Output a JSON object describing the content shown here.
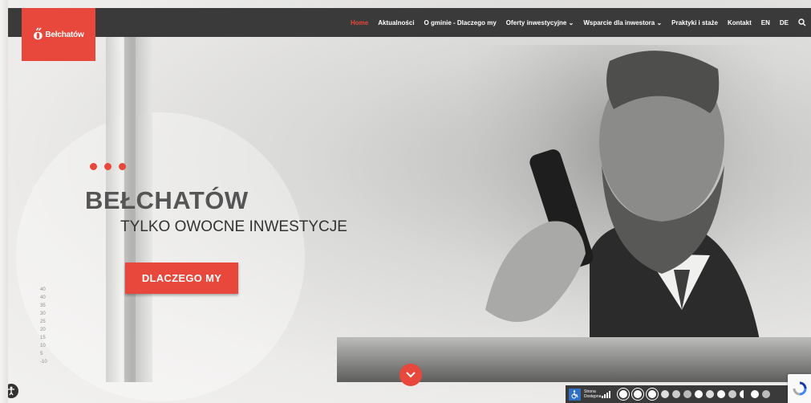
{
  "brand": {
    "logo_text": "Bełchatów",
    "accent": "#e8473b",
    "navbar_bg": "#3a3a3a"
  },
  "nav": {
    "items": [
      {
        "label": "Home",
        "active": true
      },
      {
        "label": "Aktualności"
      },
      {
        "label": "O gminie - Dlaczego my"
      },
      {
        "label": "Oferty inwestycyjne ⌄",
        "has_dropdown": true
      },
      {
        "label": "Wsparcie dla inwestora ⌄",
        "has_dropdown": true
      },
      {
        "label": "Praktyki i staże"
      },
      {
        "label": "Kontakt"
      },
      {
        "label": "EN"
      },
      {
        "label": "DE"
      }
    ],
    "search_icon": "search-icon"
  },
  "hero": {
    "title": "BEŁCHATÓW",
    "subtitle": "TYLKO OWOCNE INWESTYCJE",
    "cta_label": "DLACZEGO MY",
    "scroll_icon": "chevron-down-icon",
    "axis_numbers": [
      "40",
      "40",
      "35",
      "30",
      "25",
      "20",
      "15",
      "10",
      "5",
      "-10"
    ]
  },
  "accessibility_bar": {
    "icon": "wheelchair-icon",
    "label": "Strona Dostępna",
    "controls": [
      "contrast",
      "contrast",
      "contrast",
      "font-size",
      "font-size",
      "font-size",
      "font-size",
      "font-size",
      "font-size",
      "font-size",
      "font-size",
      "font-size",
      "font-size"
    ]
  },
  "accessibility_left_icon": "accessibility-icon",
  "recaptcha_icon": "recaptcha-icon"
}
